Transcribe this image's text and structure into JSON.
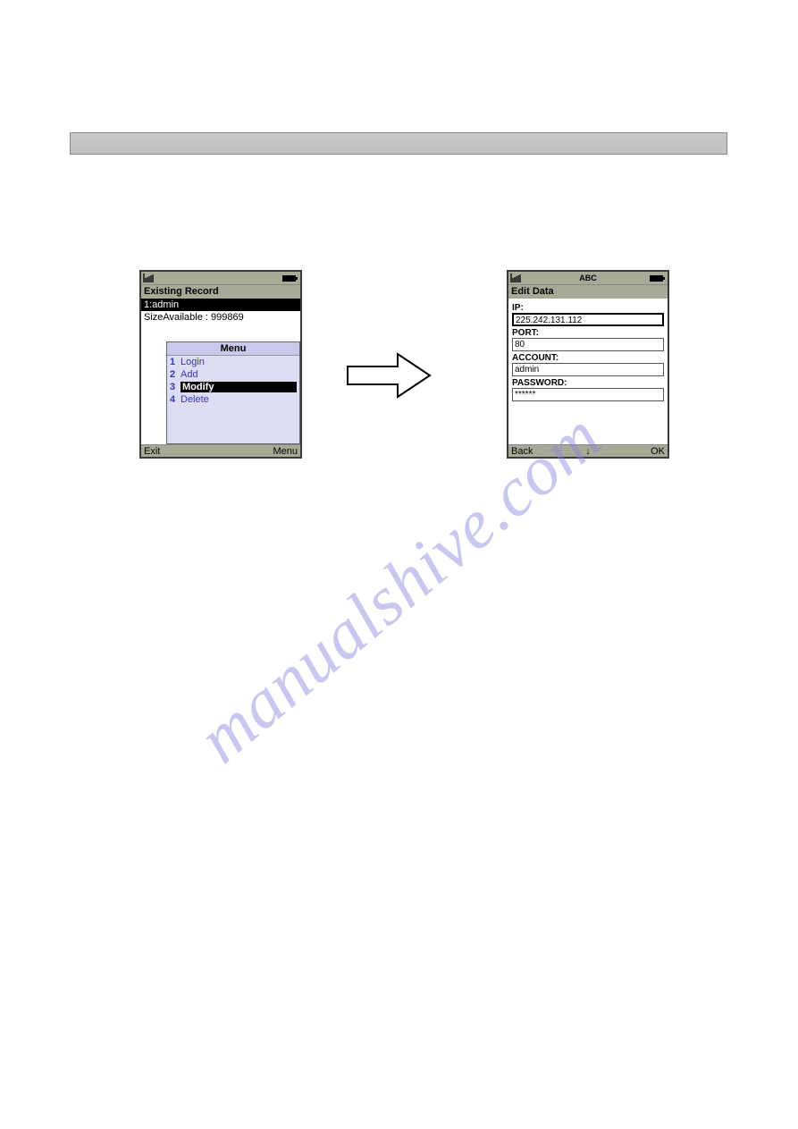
{
  "watermark": "manualshive.com",
  "left_phone": {
    "title": "Existing Record",
    "selected_record": "1:admin",
    "size_text": "SizeAvailable : 999869",
    "menu_header": "Menu",
    "menu_items": [
      {
        "num": "1",
        "label": "Login"
      },
      {
        "num": "2",
        "label": "Add"
      },
      {
        "num": "3",
        "label": "Modify"
      },
      {
        "num": "4",
        "label": "Delete"
      }
    ],
    "soft_left": "Exit",
    "soft_right": "Menu"
  },
  "right_phone": {
    "title": "Edit Data",
    "input_mode": "ABC",
    "fields": {
      "ip_label": "IP:",
      "ip_value": "225.242.131.112",
      "port_label": "PORT:",
      "port_value": "80",
      "account_label": "ACCOUNT:",
      "account_value": "admin",
      "password_label": "PASSWORD:",
      "password_value": "******"
    },
    "soft_left": "Back",
    "soft_center": "↓",
    "soft_right": "OK"
  }
}
